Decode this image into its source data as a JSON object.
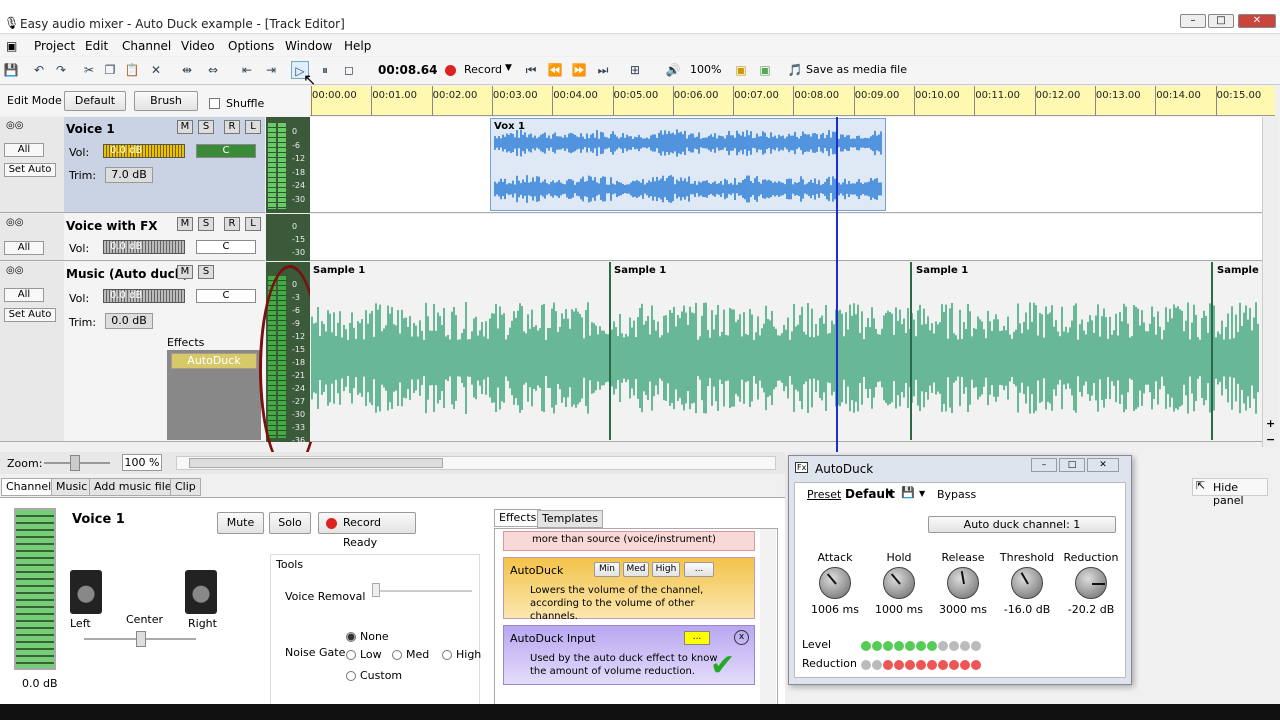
{
  "window": {
    "title": "Easy audio mixer - Auto Duck example - [Track Editor]",
    "min": "–",
    "max": "□",
    "close": "✕"
  },
  "menu": [
    "Project",
    "Edit",
    "Channel",
    "Video",
    "Options",
    "Window",
    "Help"
  ],
  "toolbar": {
    "time": "00:08.64",
    "record": "Record",
    "zoom_pct": "100%",
    "save_media": "Save as media file"
  },
  "editbar": {
    "edit_mode": "Edit Mode",
    "default": "Default",
    "brush": "Brush",
    "shuffle": "Shuffle"
  },
  "ruler": [
    "00:00.00",
    "00:01.00",
    "00:02.00",
    "00:03.00",
    "00:04.00",
    "00:05.00",
    "00:06.00",
    "00:07.00",
    "00:08.00",
    "00:09.00",
    "00:10.00",
    "00:11.00",
    "00:12.00",
    "00:13.00",
    "00:14.00",
    "00:15.00"
  ],
  "tracks": {
    "common": {
      "all": "All",
      "set_auto": "Set Auto",
      "vol": "Vol:",
      "trim": "Trim:",
      "m": "M",
      "s": "S",
      "r": "R",
      "l": "L",
      "pan": "C"
    },
    "t1": {
      "name": "Voice 1",
      "vol": "0.0 dB",
      "trim": "7.0 dB",
      "clip": "Vox 1"
    },
    "t2": {
      "name": "Voice with FX",
      "vol": "0.0 dB"
    },
    "t3": {
      "name": "Music (Auto duck)",
      "vol": "0.0 dB",
      "trim": "0.0 dB",
      "effects": "Effects",
      "effect": "AutoDuck",
      "clip": "Sample 1"
    }
  },
  "meter_scale_1": [
    "0",
    "-6",
    "-12",
    "-18",
    "-24",
    "-30"
  ],
  "meter_scale_2": [
    "0",
    "-15",
    "-30"
  ],
  "meter_scale_3": [
    "0",
    "-3",
    "-6",
    "-9",
    "-12",
    "-15",
    "-18",
    "-21",
    "-24",
    "-27",
    "-30",
    "-33",
    "-36"
  ],
  "zoombar": {
    "label": "Zoom:",
    "value": "100 %"
  },
  "tabs": [
    "Channel",
    "Music",
    "Add music file...",
    "Clip"
  ],
  "channel": {
    "name": "Voice 1",
    "mute": "Mute",
    "solo": "Solo",
    "record_ready": "Record Ready",
    "left": "Left",
    "center": "Center",
    "right": "Right",
    "db": "0.0 dB",
    "tools": "Tools",
    "voice_removal": "Voice Removal",
    "noise_gate": "Noise Gate",
    "ng": [
      "None",
      "Low",
      "Med",
      "High",
      "Custom"
    ]
  },
  "fx_tabs": [
    "Effects",
    "Templates"
  ],
  "fx_list": {
    "top_desc": "more than source (voice/instrument)",
    "autoduck": "AutoDuck",
    "ad_levels": [
      "Min",
      "Med",
      "High",
      "..."
    ],
    "ad_desc": "Lowers the volume of the channel, according to the volume of other channels.",
    "adi": "AutoDuck Input",
    "adi_btn": "...",
    "adi_desc": "Used by the auto duck effect to know the amount of volume reduction."
  },
  "hide_panel": "Hide panel",
  "dialog": {
    "title": "AutoDuck",
    "fx": "Fx",
    "preset": "Preset",
    "preset_val": "Default",
    "bypass": "Bypass",
    "channel_btn": "Auto duck channel: 1",
    "knobs": [
      {
        "name": "Attack",
        "val": "1006 ms"
      },
      {
        "name": "Hold",
        "val": "1000 ms"
      },
      {
        "name": "Release",
        "val": "3000 ms"
      },
      {
        "name": "Threshold",
        "val": "-16.0 dB"
      },
      {
        "name": "Reduction",
        "val": "-20.2 dB"
      }
    ],
    "level": "Level",
    "reduction": "Reduction"
  },
  "colors": {
    "voice_wave": "#2f7ed8",
    "music_wave": "#3aa57a",
    "playhead": "#1a2fd0",
    "highlight": "#7a1010"
  }
}
